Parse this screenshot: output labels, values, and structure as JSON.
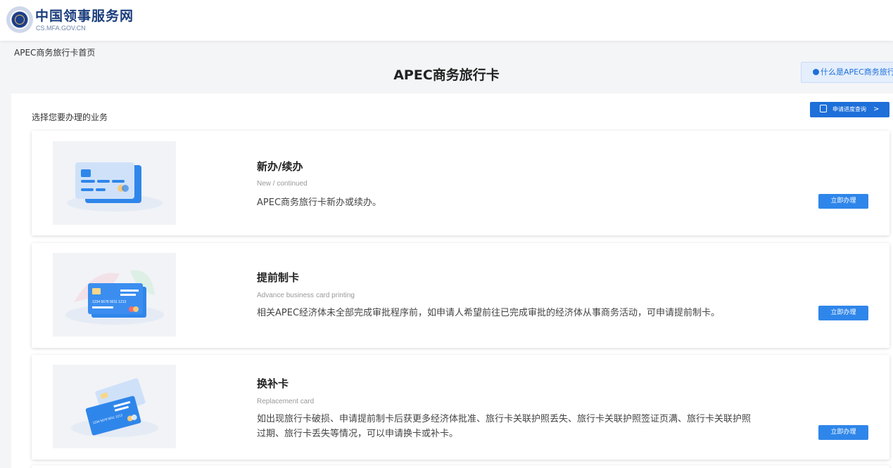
{
  "header": {
    "site_title": "中国领事服务网",
    "site_url": "CS.MFA.GOV.CN"
  },
  "breadcrumb": "APEC商务旅行卡首页",
  "page_title": "APEC商务旅行卡",
  "info_tab": "什么是APEC商务旅行卡",
  "section_label": "选择您要办理的业务",
  "progress_button": "申请进度查询",
  "cards": [
    {
      "title": "新办/续办",
      "subtitle": "New / continued",
      "description": "APEC商务旅行卡新办或续办。",
      "button": "立即办理",
      "icon": "credit-card-illustration"
    },
    {
      "title": "提前制卡",
      "subtitle": "Advance business card printing",
      "description": "相关APEC经济体未全部完成审批程序前，如申请人希望前往已完成审批的经济体从事商务活动，可申请提前制卡。",
      "button": "立即办理",
      "icon": "card-printing-illustration",
      "card_number": "1234 5678 9011 1213"
    },
    {
      "title": "换补卡",
      "subtitle": "Replacement card",
      "description": "如出现旅行卡破损、申请提前制卡后获更多经济体批准、旅行卡关联护照丢失、旅行卡关联护照签证页满、旅行卡关联护照过期、旅行卡丢失等情况，可以申请换卡或补卡。",
      "button": "立即办理",
      "icon": "replacement-card-illustration",
      "card_number": "1234 5678 9011 1213"
    }
  ],
  "colors": {
    "accent": "#1e6fd9",
    "button": "#2f86ea",
    "brand": "#1a3d7c"
  }
}
